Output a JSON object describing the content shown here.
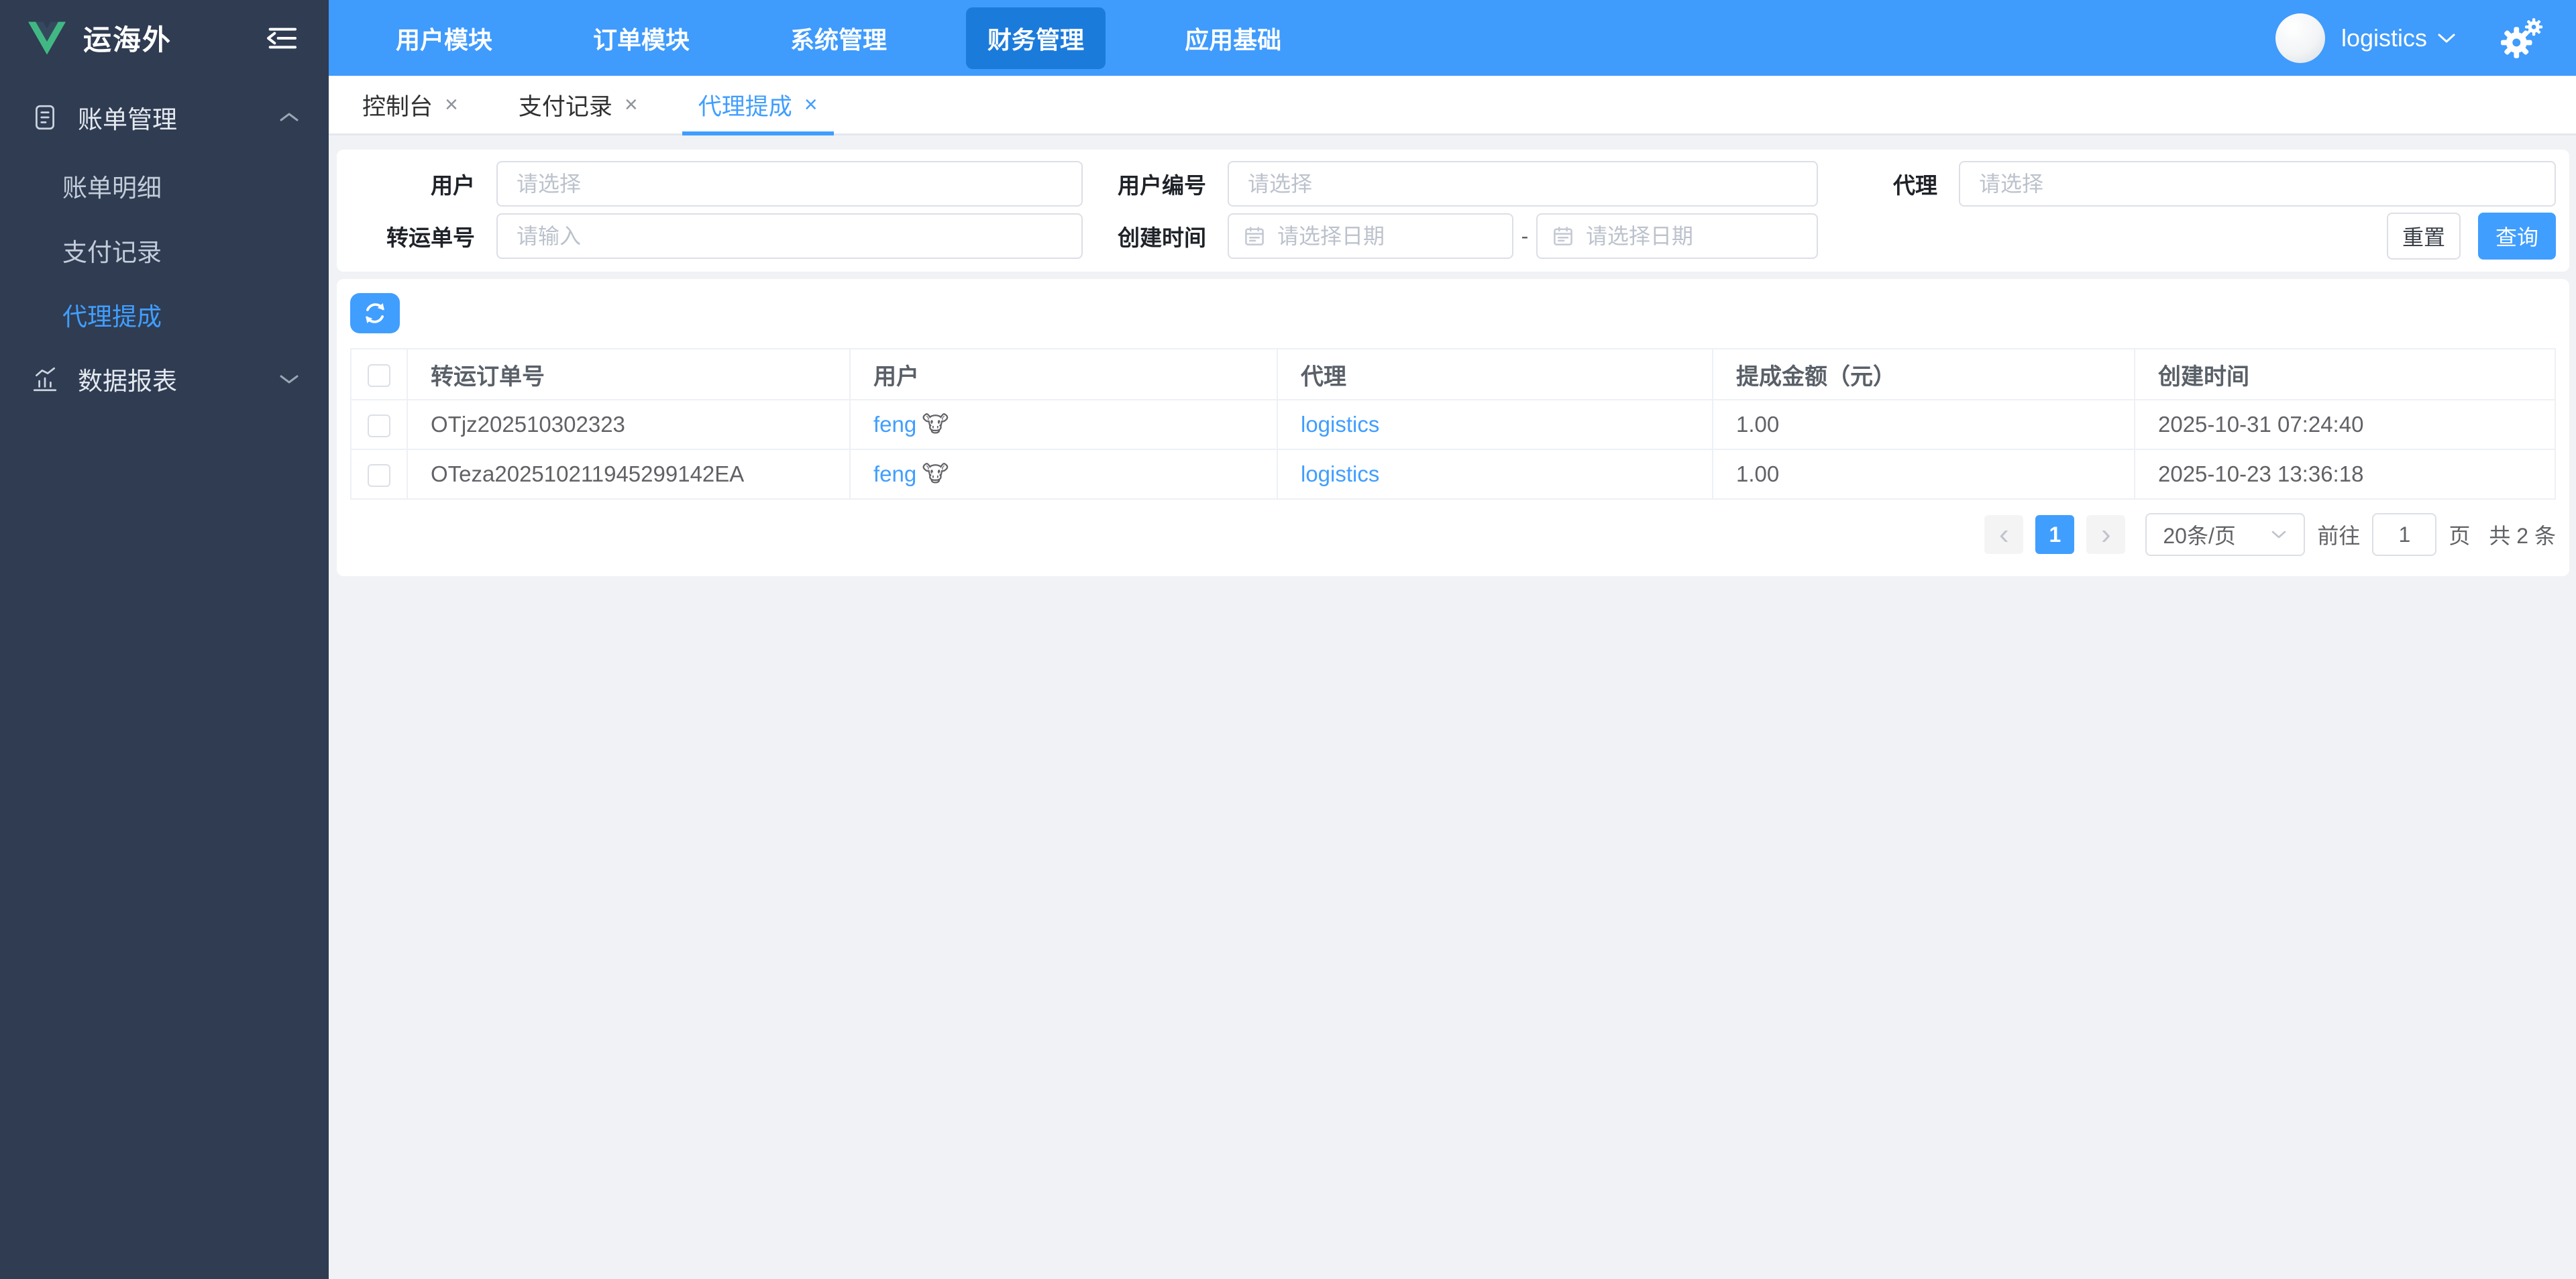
{
  "brand": {
    "title": "运海外"
  },
  "topnav": {
    "items": [
      "用户模块",
      "订单模块",
      "系统管理",
      "财务管理",
      "应用基础"
    ],
    "active": "财务管理"
  },
  "user": {
    "name": "logistics"
  },
  "sidebar": {
    "group1": {
      "label": "账单管理"
    },
    "group1_items": [
      {
        "label": "账单明细"
      },
      {
        "label": "支付记录"
      },
      {
        "label": "代理提成",
        "active": true
      }
    ],
    "group2": {
      "label": "数据报表"
    }
  },
  "tabs": {
    "close_glyph": "×",
    "items": [
      {
        "label": "控制台"
      },
      {
        "label": "支付记录"
      },
      {
        "label": "代理提成",
        "active": true
      }
    ]
  },
  "filters": {
    "user_label": "用户",
    "user_placeholder": "请选择",
    "user_no_label": "用户编号",
    "user_no_placeholder": "请选择",
    "agent_label": "代理",
    "agent_placeholder": "请选择",
    "order_no_label": "转运单号",
    "order_no_placeholder": "请输入",
    "created_label": "创建时间",
    "date_start_placeholder": "请选择日期",
    "date_end_placeholder": "请选择日期",
    "date_separator": "-",
    "reset_label": "重置",
    "search_label": "查询"
  },
  "table": {
    "columns": [
      "转运订单号",
      "用户",
      "代理",
      "提成金额（元）",
      "创建时间"
    ],
    "rows": [
      {
        "order_no": "OTjz202510302323",
        "user": "feng",
        "user_emoji": "🐮",
        "agent": "logistics",
        "amount": "1.00",
        "created": "2025-10-31 07:24:40"
      },
      {
        "order_no": "OTeza202510211945299142EA",
        "user": "feng",
        "user_emoji": "🐮",
        "agent": "logistics",
        "amount": "1.00",
        "created": "2025-10-23 13:36:18"
      }
    ]
  },
  "pagination": {
    "prev_glyph": "‹",
    "next_glyph": "›",
    "current_page": "1",
    "page_size": "20条/页",
    "goto_label": "前往",
    "goto_value": "1",
    "page_suffix": "页",
    "total": "共 2 条"
  },
  "colors": {
    "primary": "#409eff",
    "header_bg": "#3f9bfc",
    "nav_active_bg": "#1b7bdb",
    "sidebar_bg": "#2f3c52",
    "content_bg": "#f0f2f5"
  }
}
